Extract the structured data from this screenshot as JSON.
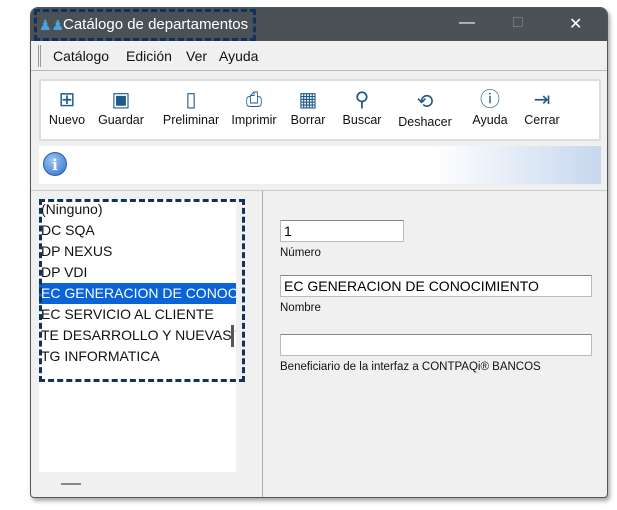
{
  "window": {
    "title": "Catálogo de departamentos"
  },
  "menu": [
    "Catálogo",
    "Edición",
    "Ver",
    "Ayuda"
  ],
  "toolbar": [
    {
      "label": "Nuevo",
      "icon": "new-file-icon"
    },
    {
      "label": "Guardar",
      "icon": "save-icon"
    },
    {
      "label": "Preliminar",
      "icon": "preview-icon"
    },
    {
      "label": "Imprimir",
      "icon": "print-icon"
    },
    {
      "label": "Borrar",
      "icon": "trash-icon"
    },
    {
      "label": "Buscar",
      "icon": "search-icon"
    },
    {
      "label": "Deshacer",
      "icon": "undo-icon"
    },
    {
      "label": "Ayuda",
      "icon": "help-icon"
    },
    {
      "label": "Cerrar",
      "icon": "exit-icon"
    }
  ],
  "list": {
    "items": [
      "(Ninguno)",
      "DC SQA",
      "DP NEXUS",
      "DP VDI",
      "EC GENERACION DE CONOCIMIENTO",
      "EC SERVICIO AL CLIENTE",
      "TE DESARROLLO Y NUEVAS TECNOLOGIAS",
      "TG INFORMATICA"
    ],
    "selected_index": 4
  },
  "form": {
    "numero": {
      "value": "1",
      "label": "Número"
    },
    "nombre": {
      "value": "EC GENERACION DE CONOCIMIENTO",
      "label": "Nombre"
    },
    "beneficiario": {
      "value": "",
      "label": "Beneficiario de la interfaz a CONTPAQi® BANCOS"
    }
  }
}
